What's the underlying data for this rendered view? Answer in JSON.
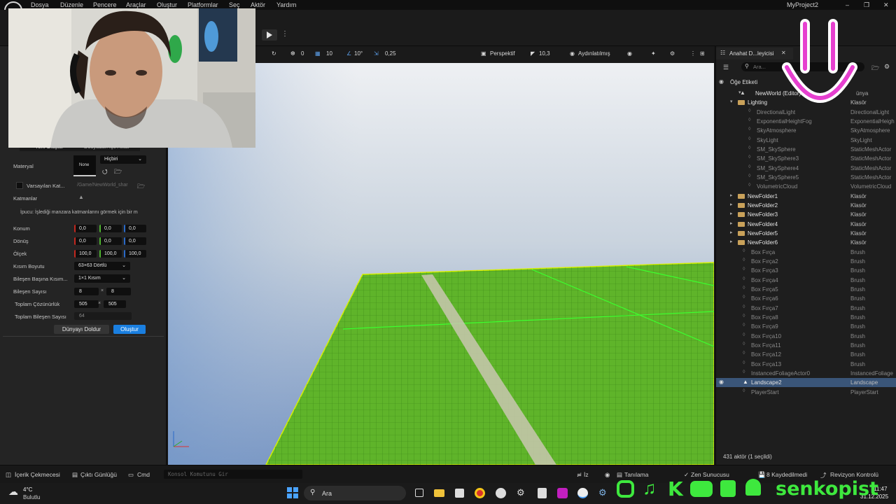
{
  "menu": {
    "items": [
      "Dosya",
      "Düzenle",
      "Pencere",
      "Araçlar",
      "Oluştur",
      "Platformlar",
      "Seç",
      "Aktör",
      "Yardım"
    ],
    "project_name": "MyProject2"
  },
  "left_panel": {
    "tab_new": "Yeni Oluştur",
    "tab_import": "Dosyadan İçe Aktar",
    "material_label": "Materyal",
    "material_thumb": "None",
    "material_value": "Hiçbiri",
    "default_layer_label": "Varsayılan Kat...",
    "default_layer_path": "/Game/NewWorld_shar",
    "layers_label": "Katmanlar",
    "tip": "İpucu: İşlediği manzara katmanlarını görmek için bir m",
    "location_label": "Konum",
    "location": [
      "0,0",
      "0,0",
      "0,0"
    ],
    "rotation_label": "Dönüş",
    "rotation": [
      "0,0",
      "0,0",
      "0,0"
    ],
    "scale_label": "Ölçek",
    "scale": [
      "100,0",
      "100,0",
      "100,0"
    ],
    "section_size_label": "Kısım Boyutu",
    "section_size": "63×63 Dörtlü",
    "sections_per_label": "Bileşen Başına Kısım...",
    "sections_per": "1×1 Kısım",
    "component_count_label": "Bileşen Sayısı",
    "component_count": [
      "8",
      "8"
    ],
    "total_resolution_label": "Toplam Çözünürlük",
    "total_resolution": [
      "505",
      "505"
    ],
    "total_components_label": "Toplam Bileşen Sayısı",
    "total_components": "64",
    "times_sign": "×",
    "fill_world_btn": "Dünyayı Doldur",
    "create_btn": "Oluştur"
  },
  "viewport_toolbar": {
    "rot_snap": "0",
    "grid_snap": "10",
    "angle_snap": "10°",
    "scale_snap": "0,25",
    "view_mode": "Perspektif",
    "camera_speed": "10,3",
    "lighting": "Aydınlatılmış"
  },
  "outliner": {
    "tab_title": "Anahat D...leyicisi",
    "search_placeholder": "Ara...",
    "col_label": "Öğe Etiketi",
    "col_type_header": "ünya",
    "root": {
      "name": "NewWorld (Editor)"
    },
    "lighting_folder": {
      "name": "Lighting",
      "type": "Klasör"
    },
    "lighting_children": [
      {
        "name": "DirectionalLight",
        "type": "DirectionalLight"
      },
      {
        "name": "ExponentialHeightFog",
        "type": "ExponentialHeigh"
      },
      {
        "name": "SkyAtmosphere",
        "type": "SkyAtmosphere"
      },
      {
        "name": "SkyLight",
        "type": "SkyLight"
      },
      {
        "name": "SM_SkySphere",
        "type": "StaticMeshActor"
      },
      {
        "name": "SM_SkySphere3",
        "type": "StaticMeshActor"
      },
      {
        "name": "SM_SkySphere4",
        "type": "StaticMeshActor"
      },
      {
        "name": "SM_SkySphere5",
        "type": "StaticMeshActor"
      },
      {
        "name": "VolumetricCloud",
        "type": "VolumetricCloud"
      }
    ],
    "folders": [
      {
        "name": "NewFolder1",
        "type": "Klasör"
      },
      {
        "name": "NewFolder2",
        "type": "Klasör"
      },
      {
        "name": "NewFolder3",
        "type": "Klasör"
      },
      {
        "name": "NewFolder4",
        "type": "Klasör"
      },
      {
        "name": "NewFolder5",
        "type": "Klasör"
      },
      {
        "name": "NewFolder6",
        "type": "Klasör"
      }
    ],
    "brushes": [
      {
        "name": "Box Fırça",
        "type": "Brush"
      },
      {
        "name": "Box Fırça2",
        "type": "Brush"
      },
      {
        "name": "Box Fırça3",
        "type": "Brush"
      },
      {
        "name": "Box Fırça4",
        "type": "Brush"
      },
      {
        "name": "Box Fırça5",
        "type": "Brush"
      },
      {
        "name": "Box Fırça6",
        "type": "Brush"
      },
      {
        "name": "Box Fırça7",
        "type": "Brush"
      },
      {
        "name": "Box Fırça8",
        "type": "Brush"
      },
      {
        "name": "Box Fırça9",
        "type": "Brush"
      },
      {
        "name": "Box Fırça10",
        "type": "Brush"
      },
      {
        "name": "Box Fırça11",
        "type": "Brush"
      },
      {
        "name": "Box Fırça12",
        "type": "Brush"
      },
      {
        "name": "Box Fırça13",
        "type": "Brush"
      }
    ],
    "foliage": {
      "name": "InstancedFoliageActor0",
      "type": "InstancedFoliage"
    },
    "selected": {
      "name": "Landscape2",
      "type": "Landscape"
    },
    "player_start": {
      "name": "PlayerStart",
      "type": "PlayerStart"
    },
    "footer": "431 aktör (1 seçildi)"
  },
  "statusbar": {
    "content_drawer": "İçerik Çekmecesi",
    "output_log": "Çıktı Günlüğü",
    "cmd": "Cmd",
    "console_placeholder": "Konsol Komutunu Gir",
    "trace": "İz",
    "derive": "Tanılama",
    "zen": "Zen Sunucusu",
    "saved": "8 Kaydedilmedi",
    "revision": "Revizyon Kontrolü"
  },
  "taskbar": {
    "temp": "4°C",
    "weather": "Bulutlu",
    "search": "Ara",
    "time": "11:47",
    "date": "31.12.2025"
  },
  "overlay": {
    "handle": "senkopist"
  },
  "colors": {
    "accent": "#1a7fe0",
    "landscape": "#5fb42a",
    "selection": "#3a5578",
    "social": "#3ee83e",
    "smiley": "#e63fcf"
  }
}
